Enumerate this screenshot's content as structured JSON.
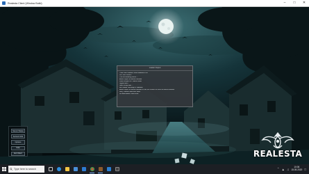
{
  "window": {
    "title": "Realesta Client (Window Build)",
    "minimize_icon": "minimize-icon",
    "maximize_icon": "maximize-icon",
    "close_icon": "close-icon"
  },
  "menu": {
    "items": [
      {
        "label": "Server Status"
      },
      {
        "label": "Account Info"
      },
      {
        "label": "Options"
      },
      {
        "label": "Help"
      },
      {
        "label": "Exit Client"
      }
    ]
  },
  "dialog": {
    "title": "Loader Output",
    "lines": [
      "Tibia Client loaded. Build Realesta 8.60",
      "Vol: Sorc 1000%",
      "The file following found. . .",
      "Editor import to Game.modules",
      "Files compile OK. Game locale",
      "Signed auth",
      "Start config load. . .",
      "Run loader bootstrap in realesta.",
      "Editor import to Game.modules to Get the content of client at Game.modules",
      "Retry Started rates and stats.",
      "All data loaded. Good luck."
    ]
  },
  "logo": {
    "text": "REALESTA"
  },
  "taskbar": {
    "search_placeholder": "Type here to search",
    "apps": [
      "task-view-icon",
      "edge-icon",
      "folder-icon",
      "store-icon",
      "mail-icon",
      "chrome-icon",
      "game-client-icon",
      "vscode-icon",
      "terminal-icon"
    ],
    "time": "10:06",
    "date": "15.05.2020"
  },
  "colors": {
    "sky": "#0e2226",
    "fog": "#3b6d73",
    "moon": "#e9f2f0",
    "accent": "#7fb6ff"
  }
}
